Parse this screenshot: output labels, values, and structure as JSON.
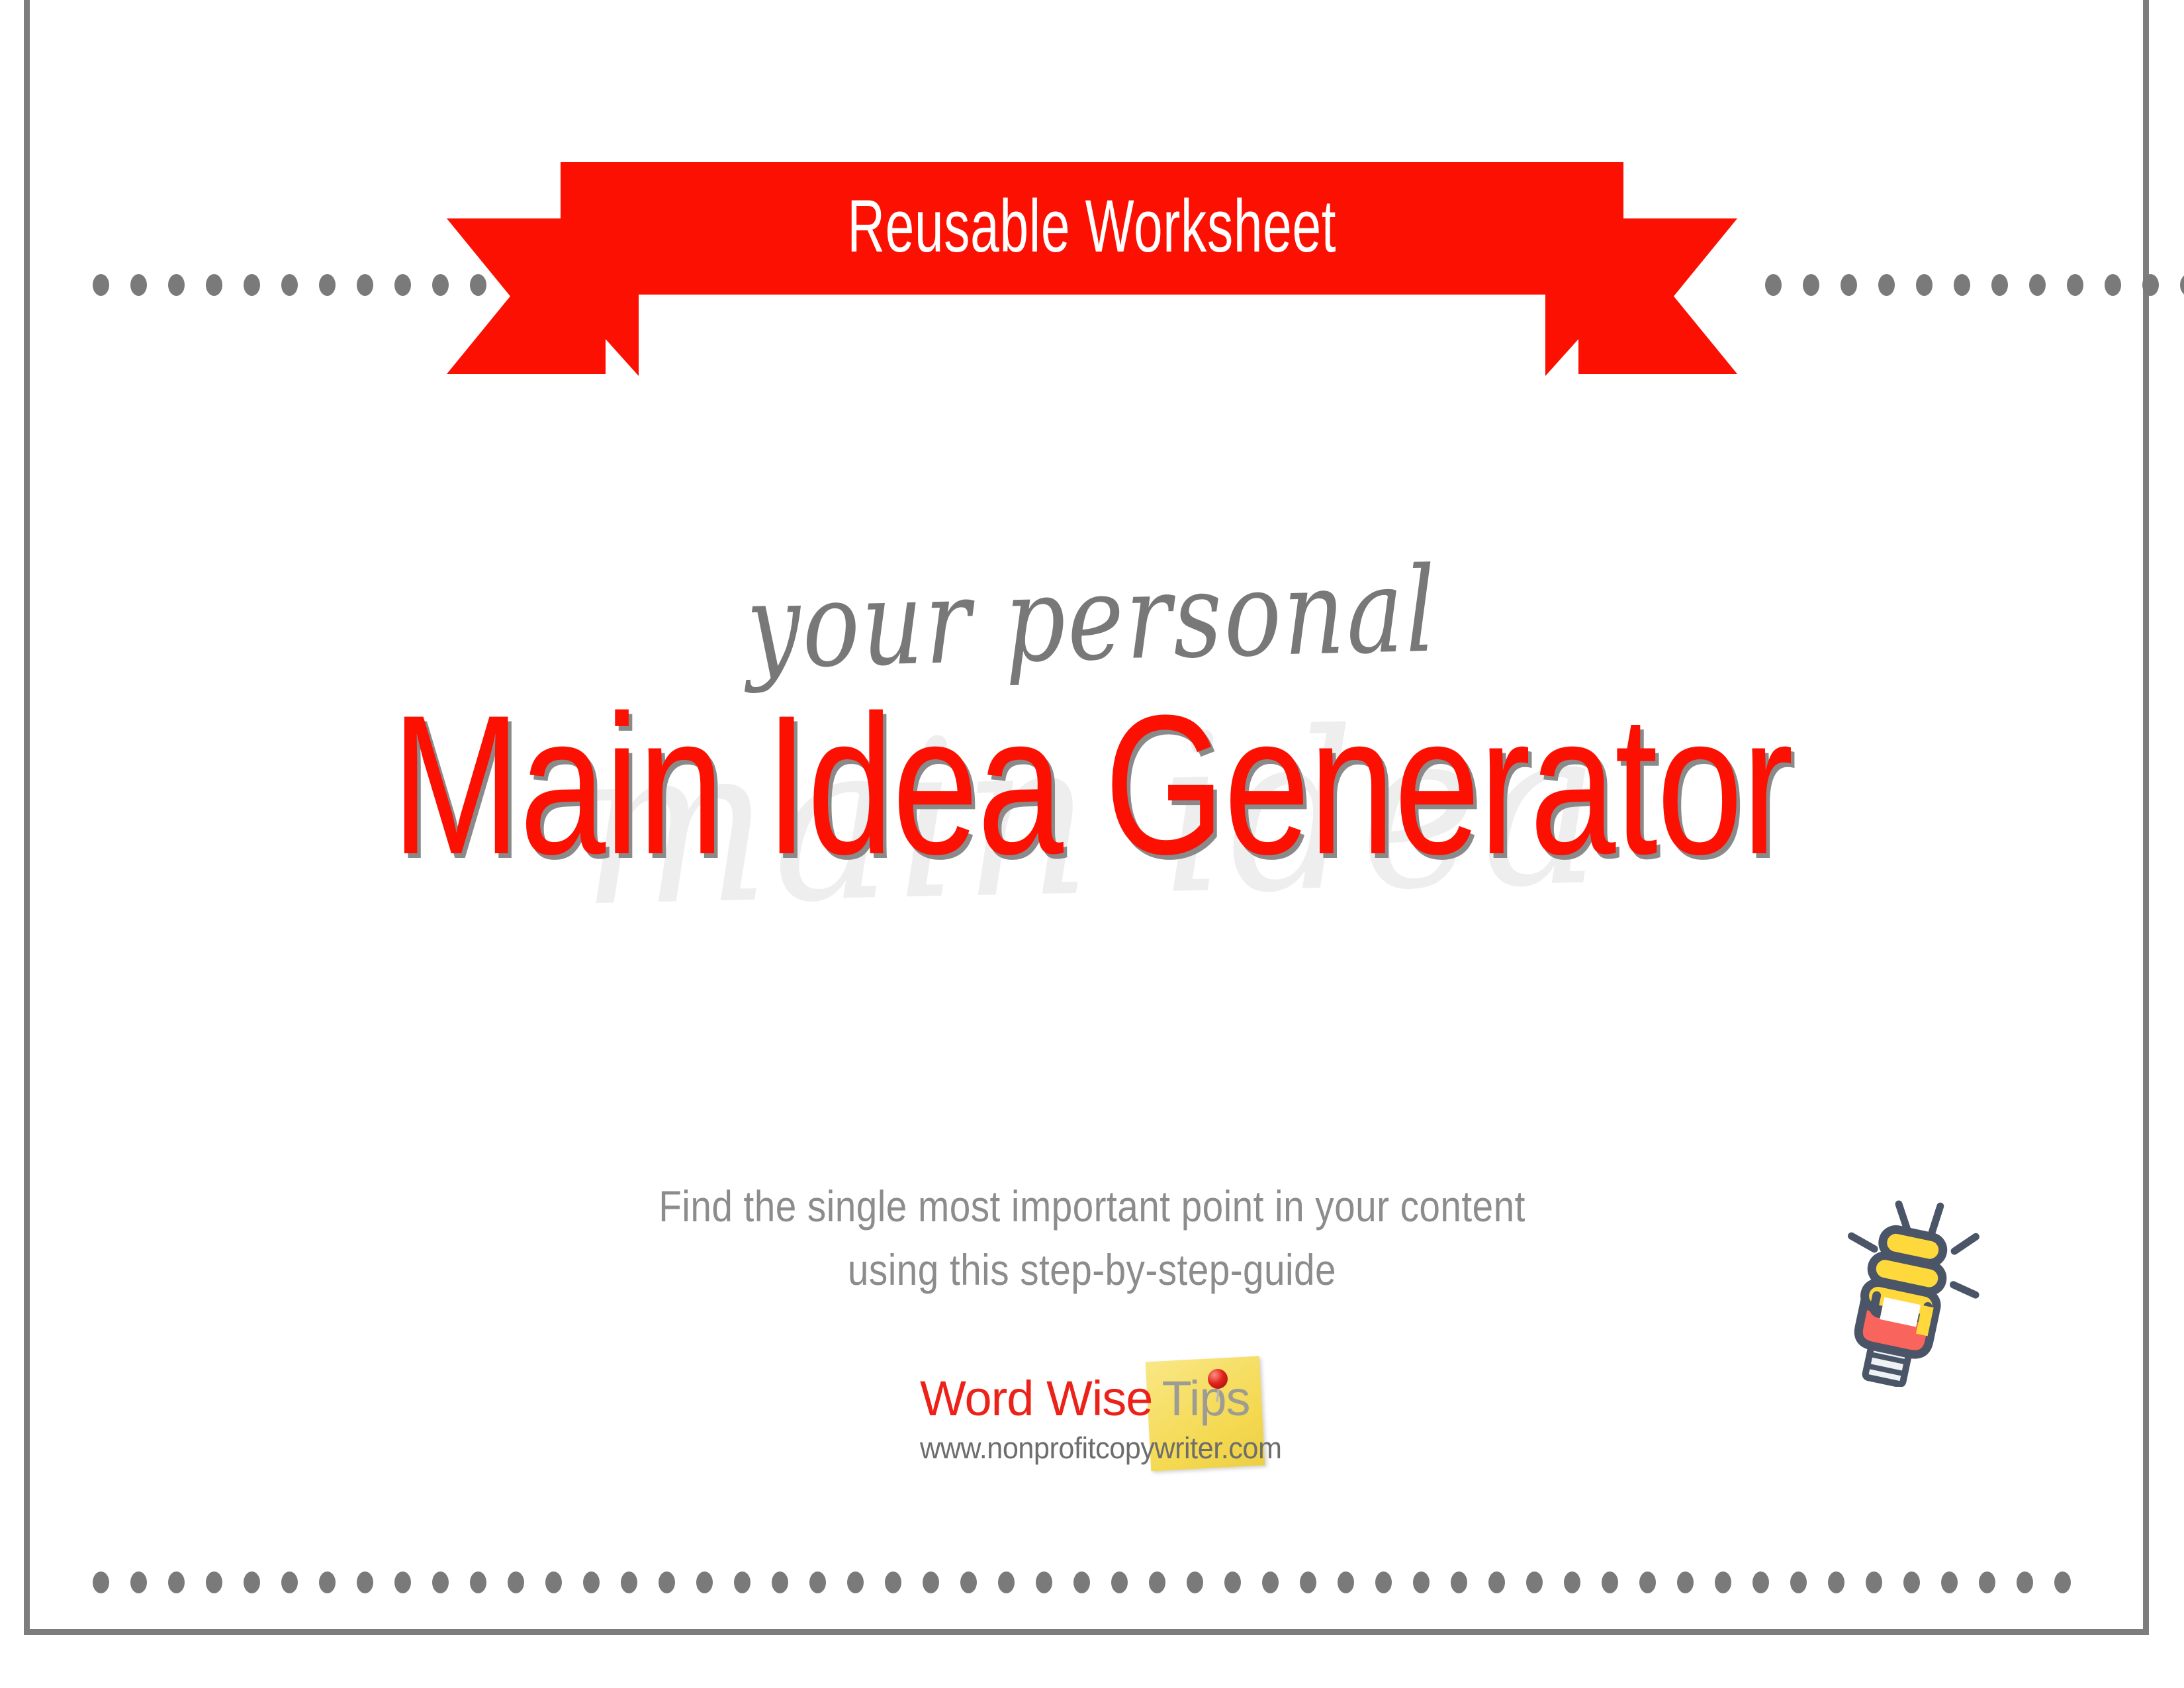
{
  "page": {
    "background_color": "#ffffff",
    "frame_color": "#7d7d7d",
    "accent_red": "#fb1002",
    "accent_gray": "#7a7a7a"
  },
  "banner": {
    "label": "Reusable Worksheet",
    "background_color": "#fb1002",
    "text_color": "#ffffff"
  },
  "decoration": {
    "dot_color": "#7a7a7a",
    "dot_rows": {
      "top_left_count": 12,
      "top_right_count": 12,
      "bottom_count": 53
    }
  },
  "title": {
    "eyebrow": "your personal",
    "eyebrow_color": "#787878",
    "main": "Main Idea Generator",
    "main_color": "#fb1002",
    "shadow_color": "#8a8a8a",
    "watermark": "main idea",
    "watermark_color": "#eeeeee"
  },
  "subtitle": {
    "line1": "Find the single most important point in your content",
    "line2": "using this step-by-step-guide",
    "color": "#8c8c8c"
  },
  "logo": {
    "word_wise": "Word Wise",
    "tips": "Tips",
    "url": "www.nonprofitcopywriter.com",
    "word_wise_color": "#ec2219",
    "tips_color": "#9c9c93",
    "url_color": "#6d6d6d",
    "sticky_note_color": "#f4d951",
    "pushpin_color": "#e0231b"
  },
  "lightbulb": {
    "icon": "lightbulb-cfl-icon",
    "outline_color": "#4a5568",
    "coil_color": "#ffd83b",
    "base_color": "#f9645c",
    "thread_color": "#eef2f5"
  }
}
